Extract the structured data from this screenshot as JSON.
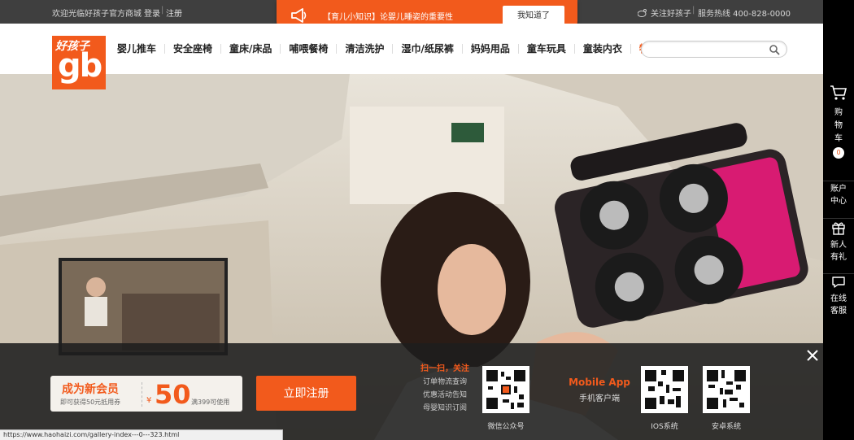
{
  "topbar": {
    "welcome": "欢迎光临好孩子官方商城",
    "login": "登录",
    "separator": "|",
    "register": "注册",
    "follow": "关注好孩子",
    "hotline": "服务热线 400-828-0000"
  },
  "notice": {
    "text": "【育儿小知识】论婴儿睡姿的重要性",
    "ok_label": "我知道了"
  },
  "logo": {
    "cn": "好孩子",
    "mark": "gb"
  },
  "nav": [
    "婴儿推车",
    "安全座椅",
    "童床/床品",
    "哺喂餐椅",
    "清洁洗护",
    "湿巾/纸尿裤",
    "妈妈用品",
    "童车玩具",
    "童装内衣",
    "特惠"
  ],
  "sidebar": {
    "cart": [
      "购",
      "物",
      "车"
    ],
    "cart_count": "0",
    "account": [
      "账户",
      "中心"
    ],
    "gift": [
      "新人",
      "有礼"
    ],
    "service": [
      "在线",
      "客服"
    ]
  },
  "promo": {
    "title": "成为新会员",
    "subtitle": "即可获得50元抵用券",
    "currency": "¥",
    "amount": "50",
    "condition": "满399可使用",
    "register_label": "立即注册",
    "scan_title": "扫一扫，关注",
    "scan_lines": [
      "订单物流查询",
      "优惠活动告知",
      "母婴知识订阅"
    ],
    "wechat_label": "微信公众号",
    "mobile_title": "Mobile App",
    "mobile_sub": "手机客户端",
    "ios_label": "IOS系统",
    "android_label": "安卓系统"
  },
  "status_url": "https://www.haohaizi.com/gallery-index---0---323.html",
  "colors": {
    "accent": "#f25a1c",
    "topbar": "#3f3f3f",
    "sidebar": "#000000"
  }
}
